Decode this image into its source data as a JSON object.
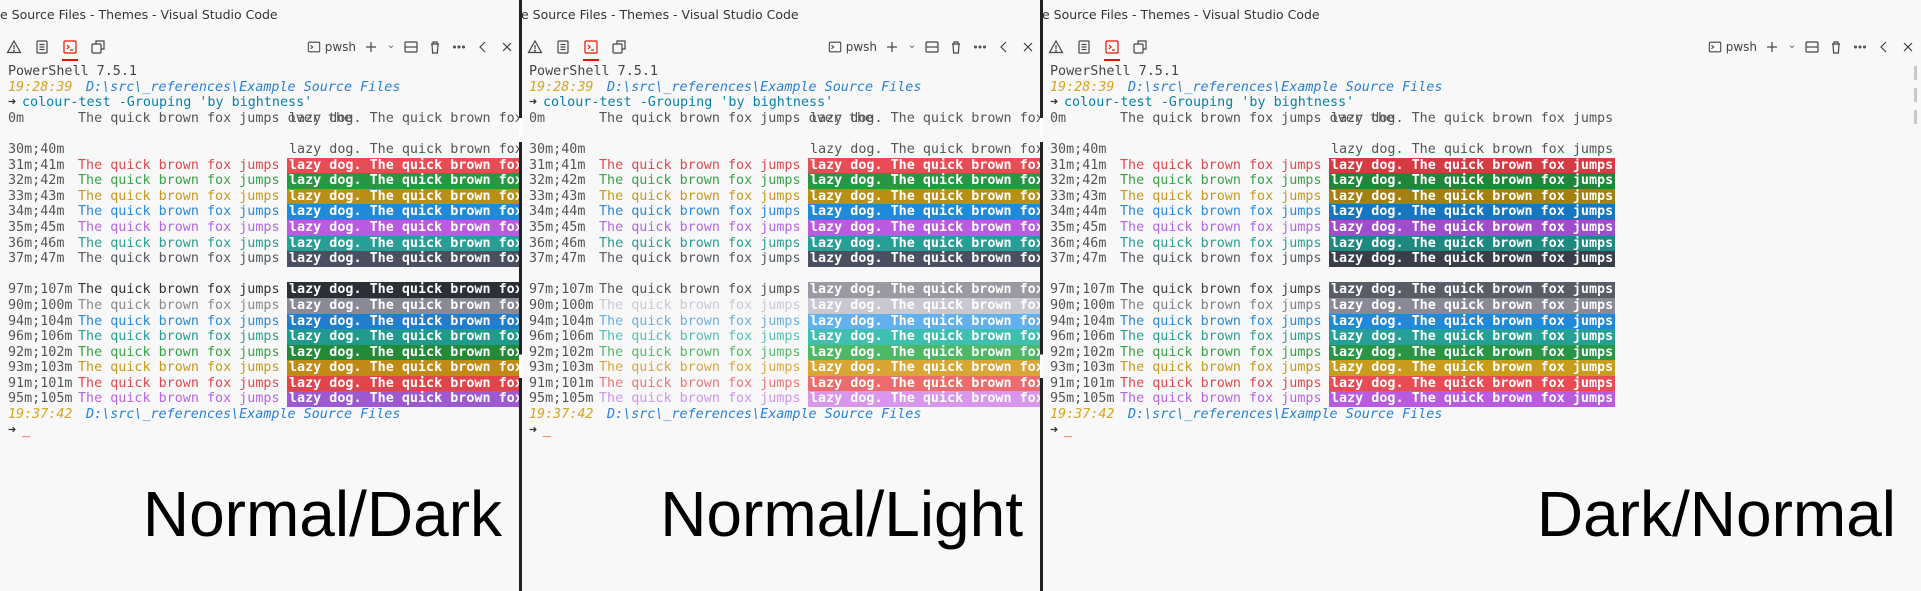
{
  "window_title": "e Source Files - Themes - Visual Studio Code",
  "terminal": {
    "shell_label": "pwsh",
    "header": "PowerShell 7.5.1",
    "prompt1_time": "19:28:39",
    "prompt_path": "D:\\src\\_references\\Example Source Files",
    "command_arrow": "➜",
    "command": "colour-test -Grouping 'by bightness'",
    "sample_left": "The quick brown fox jumps over the",
    "sample_right": "lazy dog. The quick brown fox jumps",
    "prompt2_time": "19:37:42",
    "cursor": "_",
    "row0_label": "0m",
    "group1_labels": [
      "30m;40m",
      "31m;41m",
      "32m;42m",
      "33m;43m",
      "34m;44m",
      "35m;45m",
      "36m;46m",
      "37m;47m"
    ],
    "group2_labels": [
      "97m;107m",
      "90m;100m",
      "94m;104m",
      "96m;106m",
      "92m;102m",
      "93m;103m",
      "91m;101m",
      "95m;105m"
    ]
  },
  "panels": [
    {
      "caption": "Normal/Dark",
      "group1_fg": [
        "#f8f8f8",
        "#e0484f",
        "#3aa048",
        "#c59a1e",
        "#2a8ad8",
        "#b567e0",
        "#2a9e92",
        "#555a66"
      ],
      "group1_bg": [
        "#f8f8f8",
        "#e94c55",
        "#299644",
        "#b99015",
        "#1f8ad9",
        "#b95ae0",
        "#26a096",
        "#4b5060"
      ],
      "group2_fg": [
        "#333333",
        "#8a8a8a",
        "#2a8ad8",
        "#2a9e92",
        "#3aa048",
        "#c59a1e",
        "#e0484f",
        "#b567e0"
      ],
      "group2_bg": [
        "#2b2f36",
        "#8a8a96",
        "#1f7fce",
        "#1f9a8c",
        "#238a38",
        "#c08a14",
        "#e0454c",
        "#9c59d1"
      ]
    },
    {
      "caption": "Normal/Light",
      "group1_fg": [
        "#f8f8f8",
        "#e0484f",
        "#3aa048",
        "#c59a1e",
        "#2a8ad8",
        "#b567e0",
        "#2a9e92",
        "#555a66"
      ],
      "group1_bg": [
        "#f8f8f8",
        "#e94c55",
        "#299644",
        "#b99015",
        "#1f8ad9",
        "#b95ae0",
        "#26a096",
        "#4b5060"
      ],
      "group2_fg": [
        "#555555",
        "#c8c8d8",
        "#6aaee8",
        "#54c1b3",
        "#56b86a",
        "#dba640",
        "#ec7575",
        "#cc95ee"
      ],
      "group2_bg": [
        "#9a9aa2",
        "#c8c8d0",
        "#62b0ee",
        "#3fbfb0",
        "#4fb864",
        "#d9a534",
        "#ec6c6e",
        "#d896ec"
      ]
    },
    {
      "caption": "Dark/Normal",
      "group1_fg": [
        "#f8f8f8",
        "#e0484f",
        "#3aa048",
        "#c59a1e",
        "#2a8ad8",
        "#b567e0",
        "#2a9e92",
        "#555a66"
      ],
      "group1_bg": [
        "#f8f8f8",
        "#d63a43",
        "#21853a",
        "#a3800f",
        "#1677c0",
        "#a04dcc",
        "#1c8a80",
        "#3a3e4a"
      ],
      "group2_fg": [
        "#444444",
        "#7f7f8a",
        "#2a8ad8",
        "#2a9e92",
        "#3aa048",
        "#c59a1e",
        "#e0484f",
        "#b567e0"
      ],
      "group2_bg": [
        "#5a5d66",
        "#8a8a96",
        "#1f8ad9",
        "#26a096",
        "#299644",
        "#c99c1c",
        "#e94c55",
        "#b95ae0"
      ]
    }
  ]
}
